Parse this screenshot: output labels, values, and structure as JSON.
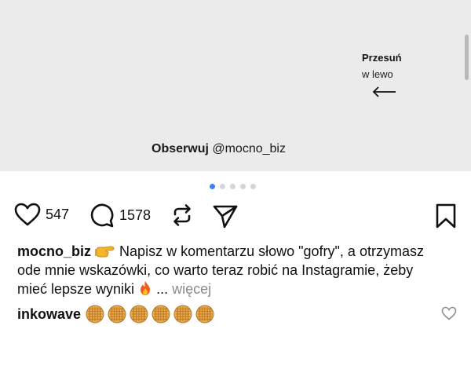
{
  "slide": {
    "swipe_title": "Przesuń",
    "swipe_subtitle": "w lewo",
    "follow_label": "Obserwuj",
    "follow_handle": "@mocno_biz"
  },
  "carousel": {
    "total_slides": 5,
    "active_index": 0
  },
  "actions": {
    "likes": "547",
    "comments": "1578",
    "icons": [
      "heart-icon",
      "comment-icon",
      "repost-icon",
      "share-icon",
      "bookmark-icon"
    ]
  },
  "caption": {
    "username": "mocno_biz",
    "emoji_icon": "pointing-hand-icon",
    "text": "Napisz w komentarzu słowo \"gofry\", a otrzymasz ode mnie wskazówki, co warto teraz robić na Instagramie, żeby mieć lepsze wyniki",
    "emoji_end_icon": "fire-icon",
    "ellipsis": "...",
    "more_label": "więcej"
  },
  "top_comment": {
    "username": "inkowave",
    "emoji_icon": "waffle-icon",
    "emoji_count": 6
  },
  "colors": {
    "accent": "#3b82f6",
    "muted": "#8a8a8a",
    "slide_bg": "#ebebeb"
  }
}
